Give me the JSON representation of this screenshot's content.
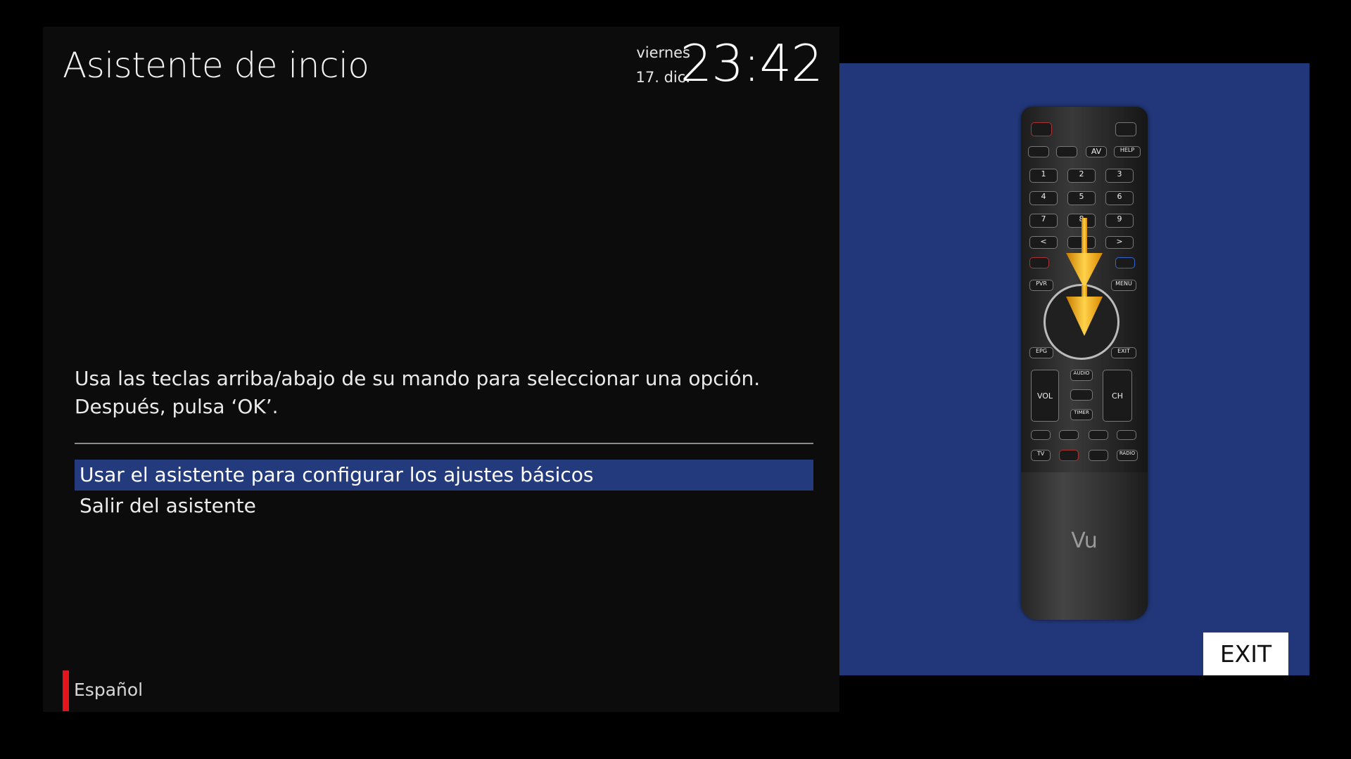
{
  "header": {
    "title": "Asistente de incio",
    "day": "viernes",
    "date": "17. dic.",
    "time": "23:42"
  },
  "instructions": {
    "line1": "Usa las teclas arriba/abajo de su mando para seleccionar una opción.",
    "line2": "Después, pulsa ‘OK’."
  },
  "menu": {
    "items": [
      {
        "label": "Usar el asistente para configurar los ajustes básicos",
        "selected": true
      },
      {
        "label": "Salir del asistente",
        "selected": false
      }
    ]
  },
  "footer": {
    "language": "Español",
    "accent_color": "#e4141b"
  },
  "remote": {
    "brand": "Vu",
    "buttons": [
      "AV",
      "HELP",
      "1",
      "2",
      "3",
      "4",
      "5",
      "6",
      "7",
      "8",
      "9",
      "<",
      ">",
      "PVR",
      "MENU",
      "EPG",
      "EXIT",
      "VOL",
      "CH",
      "AUDIO",
      "TIMER",
      "TV",
      "RADIO"
    ]
  },
  "exit_button": {
    "label": "EXIT"
  },
  "colors": {
    "selection": "#233a7d",
    "panel": "#0c0c0c",
    "remote_bg": "#213779",
    "arrow": "#f5b21a"
  }
}
